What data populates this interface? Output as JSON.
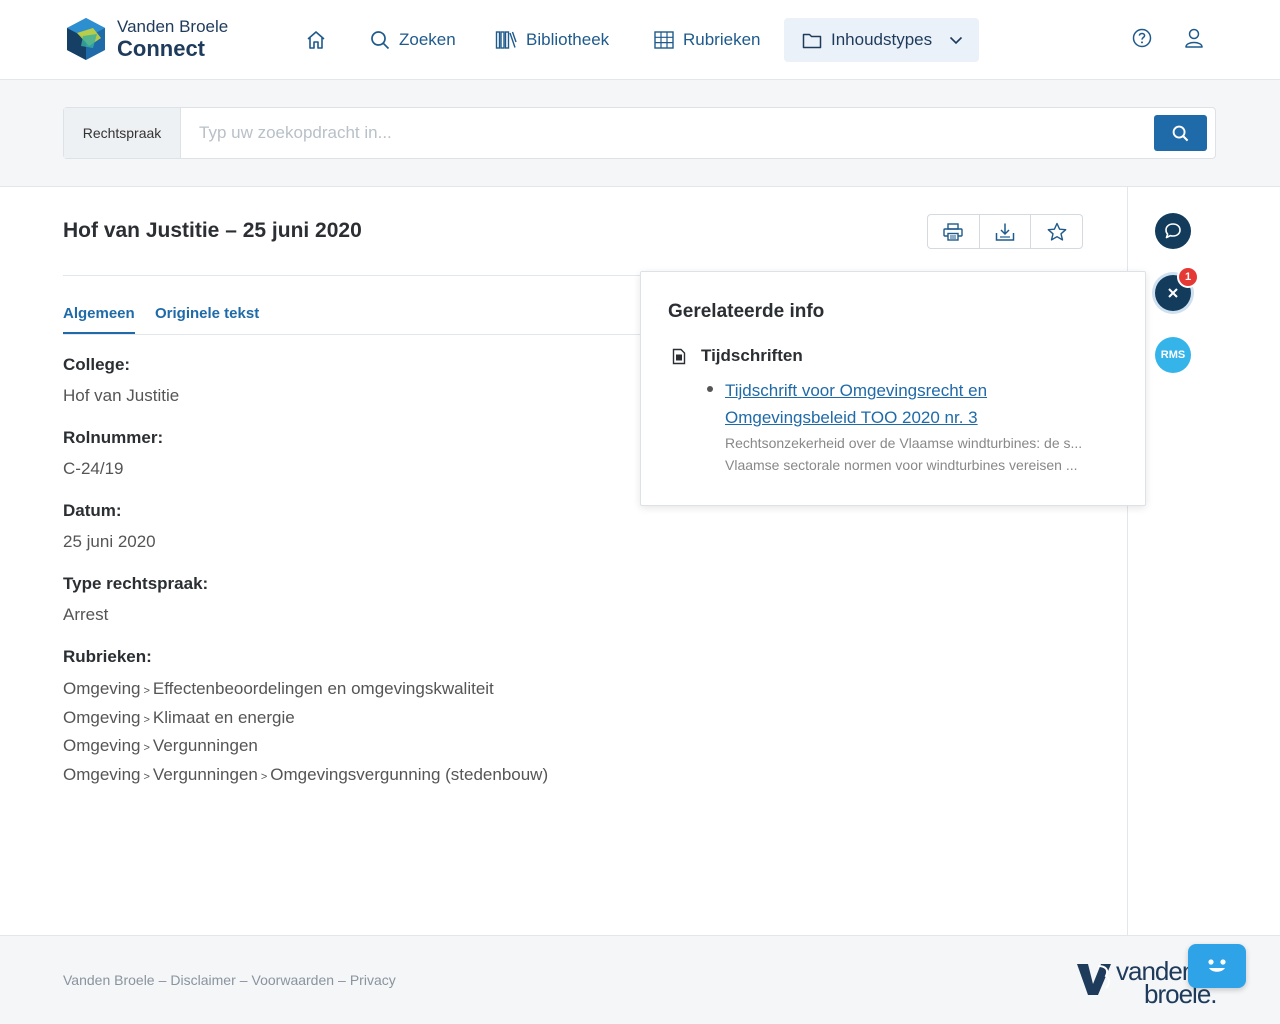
{
  "header": {
    "brand_line1": "Vanden Broele",
    "brand_line2": "Connect",
    "nav": {
      "zoeken": "Zoeken",
      "bibliotheek": "Bibliotheek",
      "rubrieken": "Rubrieken",
      "inhoudstypes": "Inhoudstypes"
    }
  },
  "search": {
    "scope": "Rechtspraak",
    "placeholder": "Typ uw zoekopdracht in...",
    "value": ""
  },
  "document": {
    "title": "Hof van Justitie – 25 juni 2020",
    "tabs": [
      "Algemeen",
      "Originele tekst"
    ],
    "fields": [
      {
        "label": "College:",
        "value": "Hof van Justitie"
      },
      {
        "label": "Rolnummer:",
        "value": "C-24/19"
      },
      {
        "label": "Datum:",
        "value": "25 juni 2020"
      },
      {
        "label": "Type rechtspraak:",
        "value": "Arrest"
      }
    ],
    "rubrieken_label": "Rubrieken:",
    "rubrieken": [
      [
        "Omgeving",
        "Effectenbeoordelingen en omgevingskwaliteit"
      ],
      [
        "Omgeving",
        "Klimaat en energie"
      ],
      [
        "Omgeving",
        "Vergunningen"
      ],
      [
        "Omgeving",
        "Vergunningen",
        "Omgevingsvergunning (stedenbouw)"
      ]
    ],
    "separator": ">"
  },
  "related": {
    "title": "Gerelateerde info",
    "category": "Tijdschriften",
    "link": "Tijdschrift voor Omgevingsrecht en Omgevingsbeleid TOO 2020 nr. 3",
    "snippet1": "Rechtsonzekerheid over de Vlaamse windturbines: de s...",
    "snippet2": "Vlaamse sectorale normen voor windturbines vereisen ..."
  },
  "rail": {
    "badge_count": "1",
    "rms_label": "RMS"
  },
  "footer": {
    "links": [
      "Vanden Broele",
      "Disclaimer",
      "Voorwaarden",
      "Privacy"
    ],
    "separator": "–",
    "logo_line1": "vanden",
    "logo_line2": "broele."
  },
  "colors": {
    "primary": "#1f6aa8",
    "navy": "#123b5c",
    "rms": "#35b4ea",
    "badge": "#e53935"
  },
  "icons": [
    "home-icon",
    "search-icon",
    "library-icon",
    "grid-icon",
    "folder-icon",
    "chevron-down-icon",
    "help-icon",
    "user-icon",
    "print-icon",
    "download-icon",
    "star-icon",
    "chat-icon",
    "close-icon",
    "document-icon",
    "chatbot-icon"
  ]
}
